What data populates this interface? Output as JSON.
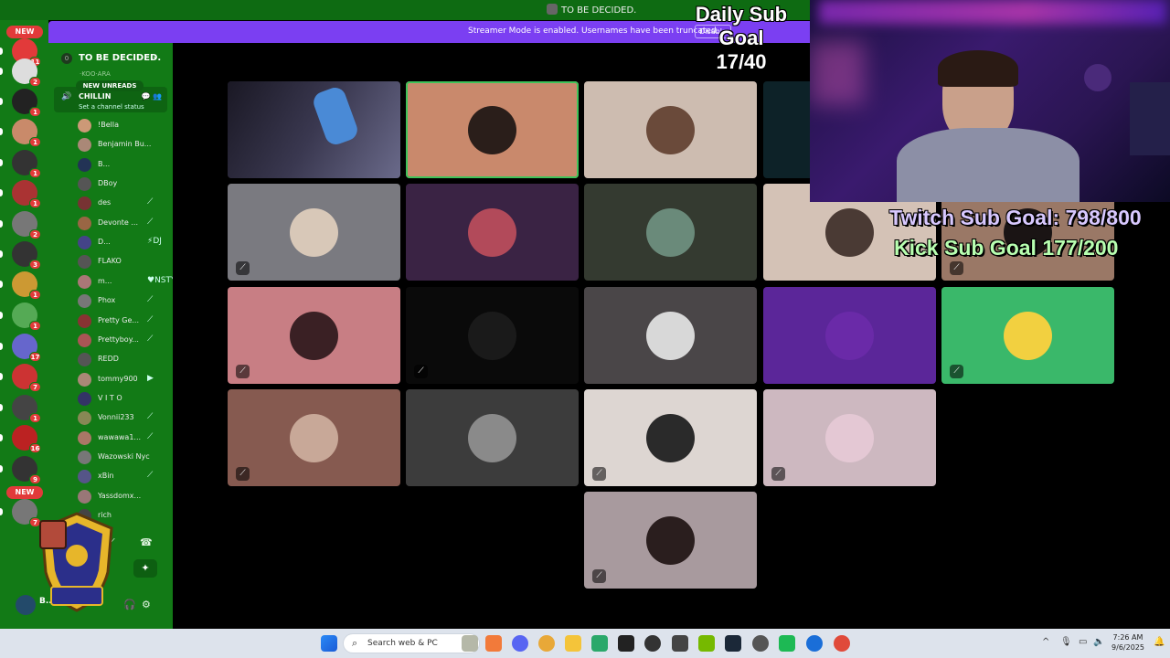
{
  "window": {
    "title": "TO BE DECIDED."
  },
  "streamer_banner": {
    "message": "Streamer Mode is enabled. Usernames have been truncated.",
    "disable_label": "Disable"
  },
  "server": {
    "name": "TO BE DECIDED.",
    "boost_level": "0",
    "new_unreads": "NEW UNREADS"
  },
  "rail": {
    "badges": [
      {
        "label": "NEW",
        "count": "11",
        "color": "#e23a3a"
      },
      {
        "count": "2",
        "color": "#ddd"
      },
      {
        "count": "1",
        "color": "#222"
      },
      {
        "count": "1",
        "color": "#c98a6a"
      },
      {
        "count": "1",
        "color": "#333"
      },
      {
        "count": "1",
        "color": "#a33"
      },
      {
        "count": "2",
        "color": "#777"
      },
      {
        "count": "3",
        "color": "#333"
      },
      {
        "count": "1",
        "color": "#c93"
      },
      {
        "count": "1",
        "color": "#5a5"
      },
      {
        "count": "17",
        "color": "#66c"
      },
      {
        "count": "7",
        "color": "#c33"
      },
      {
        "count": "1",
        "color": "#444"
      },
      {
        "count": "16",
        "color": "#b22"
      },
      {
        "count": "9",
        "color": "#333"
      },
      {
        "label": "NEW",
        "count": "7",
        "color": "#777"
      }
    ]
  },
  "voice_channel": {
    "name": "CHILLIN",
    "status_placeholder": "Set a channel status",
    "cut_above": "·KOO·ARA"
  },
  "members": [
    {
      "name": "!Bella",
      "status": "",
      "color": "#c97"
    },
    {
      "name": "Benjamin Bu...",
      "status": "",
      "color": "#a87"
    },
    {
      "name": "B...",
      "status": "",
      "color": "#235"
    },
    {
      "name": "DBoy",
      "status": "",
      "color": "#555"
    },
    {
      "name": "des",
      "status": "mute",
      "color": "#733"
    },
    {
      "name": "Devonte ...",
      "status": "mute",
      "color": "#964"
    },
    {
      "name": "D...",
      "status": "DJ",
      "color": "#448"
    },
    {
      "name": "FLAKO",
      "status": "",
      "color": "#555"
    },
    {
      "name": "m...",
      "status": "NSTY",
      "color": "#a77"
    },
    {
      "name": "Phox",
      "status": "mute",
      "color": "#777"
    },
    {
      "name": "Pretty Ge...",
      "status": "mute",
      "color": "#833"
    },
    {
      "name": "Prettyboy...",
      "status": "mute",
      "color": "#a55"
    },
    {
      "name": "REDD",
      "status": "",
      "color": "#555"
    },
    {
      "name": "tommy900",
      "status": "camera",
      "color": "#a87"
    },
    {
      "name": "V I T O",
      "status": "",
      "color": "#336"
    },
    {
      "name": "Vonnii233",
      "status": "mute",
      "color": "#885"
    },
    {
      "name": "wawawa1...",
      "status": "mute",
      "color": "#a76"
    },
    {
      "name": "Wazowski Nyc",
      "status": "",
      "color": "#777"
    },
    {
      "name": "xBin",
      "status": "mute",
      "color": "#558"
    },
    {
      "name": "Yassdomx...",
      "status": "",
      "color": "#977"
    },
    {
      "name": "rich",
      "status": "",
      "color": "#444"
    }
  ],
  "user_panel": {
    "name": "B..."
  },
  "tiles": [
    {
      "bg": "#2a2838",
      "avatar": "#556",
      "muted": false,
      "video": true
    },
    {
      "bg": "#c9896c",
      "avatar": "#2a1e1a",
      "muted": false,
      "active": true
    },
    {
      "bg": "#cdbcb0",
      "avatar": "#6a4a3a",
      "muted": false
    },
    {
      "bg": "#0d2228",
      "avatar": "#24383c",
      "muted": false
    },
    {
      "bg": "#221a1a",
      "avatar": "#5a3a32",
      "muted": true
    },
    {
      "bg": "#7a7a80",
      "avatar": "#d8c8b8",
      "muted": true
    },
    {
      "bg": "#3a2344",
      "avatar": "#b24a5a",
      "muted": false
    },
    {
      "bg": "#343a30",
      "avatar": "#6a8a7a",
      "muted": false
    },
    {
      "bg": "#d4c2b6",
      "avatar": "#4a3a34",
      "muted": false
    },
    {
      "bg": "#9a7866",
      "avatar": "#1a1414",
      "muted": true
    },
    {
      "bg": "#c87e84",
      "avatar": "#3a2024",
      "muted": true
    },
    {
      "bg": "#0a0a0a",
      "avatar": "#1a1a1a",
      "muted": true
    },
    {
      "bg": "#4a4648",
      "avatar": "#d8d8d8",
      "muted": false
    },
    {
      "bg": "#5b2699",
      "avatar": "#6a2aa8",
      "muted": false
    },
    {
      "bg": "#3ab86a",
      "avatar": "#f2d040",
      "muted": true
    },
    {
      "bg": "#865a50",
      "avatar": "#c8a898",
      "muted": true
    },
    {
      "bg": "#3c3c3c",
      "avatar": "#8a8a8a",
      "muted": false
    },
    {
      "bg": "#ddd6d2",
      "avatar": "#2a2a2a",
      "muted": true
    },
    {
      "bg": "#cdb8c0",
      "avatar": "#e4c8d4",
      "muted": true
    },
    {
      "bg": "#a89a9e",
      "avatar": "#2a1e1e",
      "muted": true
    }
  ],
  "overlays": {
    "daily_sub_goal_line1": "Daily Sub Goal",
    "daily_sub_goal_line2": "17/40",
    "twitch_sub_goal": "Twitch Sub Goal: 798/800",
    "kick_sub_goal": "Kick Sub Goal  177/200"
  },
  "taskbar": {
    "search_placeholder": "Search web & PC",
    "time": "7:26 AM",
    "date": "9/6/2025",
    "apps": [
      "windows-start",
      "search",
      "brave",
      "discord",
      "chrome",
      "file-explorer",
      "store",
      "steam-alt",
      "github",
      "nvidia",
      "steam",
      "crosshair",
      "spotify",
      "edge",
      "chrome-2",
      "chrome-3"
    ]
  },
  "colors": {
    "discord_green_theme": "#127a16",
    "streamer_purple": "#7b3ff2",
    "badge_red": "#e23a3a"
  }
}
